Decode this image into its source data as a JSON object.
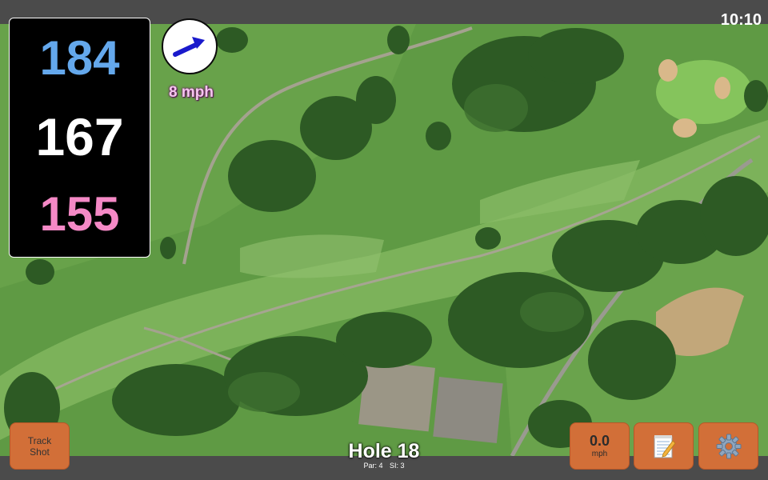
{
  "status_bar": {
    "time": "10:10"
  },
  "distances": {
    "back": "184",
    "center": "167",
    "front": "155"
  },
  "wind": {
    "speed_label": "8 mph",
    "arrow_icon": "wind-arrow-icon"
  },
  "hole": {
    "title": "Hole 18",
    "par": "Par: 4",
    "stroke_index": "SI: 3"
  },
  "buttons": {
    "track_shot": "Track\nShot",
    "wind_value": "0.0",
    "wind_unit": "mph",
    "notes_icon": "notepad-icon",
    "settings_icon": "gear-icon"
  },
  "colors": {
    "back": "#64a8ec",
    "center": "#ffffff",
    "front": "#f589c6",
    "button": "#d26f38",
    "wind_label": "#f5c6ee"
  }
}
